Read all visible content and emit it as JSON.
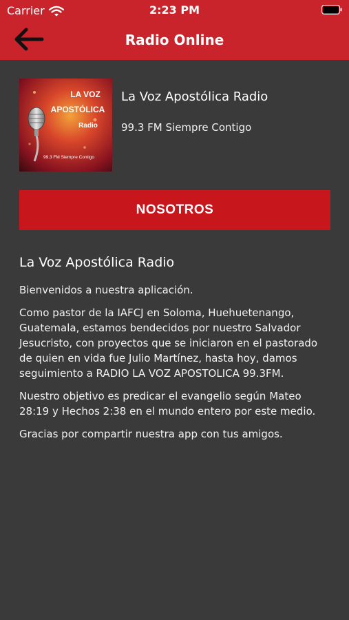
{
  "status_bar": {
    "carrier": "Carrier",
    "time": "2:23 PM"
  },
  "nav": {
    "title": "Radio Online",
    "back_icon": "arrow-left-icon"
  },
  "station": {
    "name": "La Voz Apostólica Radio",
    "tagline": "99.3 FM Siempre Contigo",
    "logo": {
      "line1": "LA VOZ",
      "line2": "APOSTÓLICA",
      "line3": "Radio",
      "line4": "99.3 FM Siempre Contigo"
    }
  },
  "tab": {
    "label": "NOSOTROS"
  },
  "content": {
    "title": "La Voz Apostólica Radio",
    "paragraphs": [
      "Bienvenidos a nuestra aplicación.",
      "Como pastor de la IAFCJ en Soloma, Huehuetenango, Guatemala, estamos bendecidos por nuestro Salvador Jesucristo, con proyectos que se iniciaron en el pastorado de quien en vida fue Julio Martínez, hasta hoy, damos seguimiento a RADIO LA VOZ APOSTOLICA 99.3FM.",
      "Nuestro objetivo es predicar el evangelio según Mateo 28:19 y Hechos 2:38 en el mundo entero por este medio.",
      "Gracias por compartir nuestra app con tus amigos."
    ]
  },
  "colors": {
    "header": "#c9242b",
    "button": "#c8161d",
    "background": "#3a3a3a"
  }
}
